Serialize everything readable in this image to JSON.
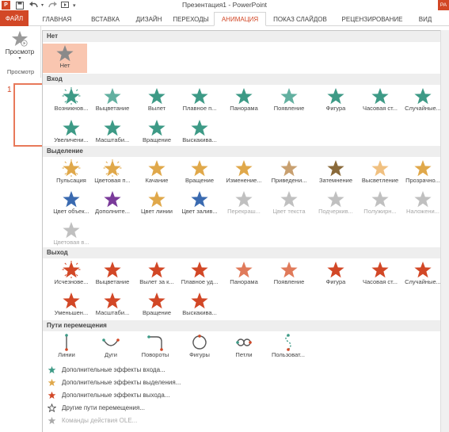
{
  "titlebar": {
    "title": "Презентация1 - PowerPoint",
    "app_logo": "P",
    "badge": "РА",
    "icons": [
      "save-icon",
      "undo-icon",
      "redo-icon",
      "start-icon",
      "customize-icon"
    ]
  },
  "tabs": [
    {
      "label": "ФАЙЛ"
    },
    {
      "label": "ГЛАВНАЯ"
    },
    {
      "label": "ВСТАВКА"
    },
    {
      "label": "ДИЗАЙН"
    },
    {
      "label": "ПЕРЕХОДЫ"
    },
    {
      "label": "АНИМАЦИЯ"
    },
    {
      "label": "ПОКАЗ СЛАЙДОВ"
    },
    {
      "label": "РЕЦЕНЗИРОВАНИЕ"
    },
    {
      "label": "ВИД"
    }
  ],
  "preview": {
    "button_label": "Просмотр",
    "group_label": "Просмотр"
  },
  "slide_thumb": {
    "number": "1"
  },
  "gallery": {
    "sections": [
      {
        "title": "Нет",
        "items": [
          {
            "label": "Нет",
            "color": "#8a8a8a",
            "icon": "star-none-icon",
            "selected": true
          }
        ]
      },
      {
        "title": "Вход",
        "items": [
          {
            "label": "Возникнов...",
            "color": "#3d9a86",
            "icon": "appear-burst-icon"
          },
          {
            "label": "Выцветание",
            "color": "#62b0a0",
            "icon": "fade-star-icon"
          },
          {
            "label": "Вылет",
            "color": "#3d9a86",
            "icon": "fly-in-icon"
          },
          {
            "label": "Плавное п...",
            "color": "#3d9a86",
            "icon": "float-in-icon"
          },
          {
            "label": "Панорама",
            "color": "#3d9a86",
            "icon": "split-icon"
          },
          {
            "label": "Появление",
            "color": "#62b0a0",
            "icon": "wipe-icon"
          },
          {
            "label": "Фигура",
            "color": "#3d9a86",
            "icon": "shape-icon"
          },
          {
            "label": "Часовая ст...",
            "color": "#3d9a86",
            "icon": "wheel-icon"
          },
          {
            "label": "Случайные...",
            "color": "#3d9a86",
            "icon": "random-bars-icon"
          },
          {
            "label": "Увеличени...",
            "color": "#3d9a86",
            "icon": "grow-turn-icon"
          },
          {
            "label": "Масштаби...",
            "color": "#3d9a86",
            "icon": "zoom-icon"
          },
          {
            "label": "Вращение",
            "color": "#3d9a86",
            "icon": "swivel-icon"
          },
          {
            "label": "Выскакива...",
            "color": "#3d9a86",
            "icon": "bounce-icon"
          }
        ]
      },
      {
        "title": "Выделение",
        "items": [
          {
            "label": "Пульсация",
            "color": "#e0a84a",
            "icon": "pulse-icon"
          },
          {
            "label": "Цветовая п...",
            "color": "#e0a84a",
            "icon": "color-pulse-icon"
          },
          {
            "label": "Качание",
            "color": "#e0a84a",
            "icon": "teeter-icon"
          },
          {
            "label": "Вращение",
            "color": "#e0a84a",
            "icon": "spin-icon"
          },
          {
            "label": "Изменение...",
            "color": "#e0a84a",
            "icon": "grow-shrink-icon"
          },
          {
            "label": "Приведени...",
            "color": "#c8a070",
            "icon": "desaturate-icon"
          },
          {
            "label": "Затемнение",
            "color": "#8a6a3a",
            "icon": "darken-icon"
          },
          {
            "label": "Высветление",
            "color": "#f0c080",
            "icon": "lighten-icon"
          },
          {
            "label": "Прозрачно...",
            "color": "#e0a84a",
            "icon": "transparency-icon"
          },
          {
            "label": "Цвет объек...",
            "color": "#3a6ab0",
            "icon": "object-color-icon"
          },
          {
            "label": "Дополните...",
            "color": "#7a3a9a",
            "icon": "complementary-color-icon"
          },
          {
            "label": "Цвет линии",
            "color": "#e0a84a",
            "icon": "line-color-icon"
          },
          {
            "label": "Цвет залив...",
            "color": "#3a6ab0",
            "icon": "fill-color-icon"
          },
          {
            "label": "Перекраш...",
            "color": "#b0b0b0",
            "icon": "brush-color-icon",
            "disabled": true
          },
          {
            "label": "Цвет текста",
            "color": "#b0b0b0",
            "icon": "font-color-icon",
            "disabled": true
          },
          {
            "label": "Подчеркив...",
            "color": "#b0b0b0",
            "icon": "underline-icon",
            "disabled": true
          },
          {
            "label": "Полужирн...",
            "color": "#b0b0b0",
            "icon": "bold-flash-icon",
            "disabled": true
          },
          {
            "label": "Наложени...",
            "color": "#b0b0b0",
            "icon": "bold-reveal-icon",
            "disabled": true
          },
          {
            "label": "Цветовая в...",
            "color": "#b0b0b0",
            "icon": "wave-icon",
            "disabled": true
          }
        ]
      },
      {
        "title": "Выход",
        "items": [
          {
            "label": "Исчезнове...",
            "color": "#d24726",
            "icon": "disappear-burst-icon"
          },
          {
            "label": "Выцветание",
            "color": "#d24726",
            "icon": "fade-out-icon"
          },
          {
            "label": "Вылет за к...",
            "color": "#d24726",
            "icon": "fly-out-icon"
          },
          {
            "label": "Плавное уд...",
            "color": "#d24726",
            "icon": "float-out-icon"
          },
          {
            "label": "Панорама",
            "color": "#e07a5a",
            "icon": "split-out-icon"
          },
          {
            "label": "Появление",
            "color": "#e07a5a",
            "icon": "wipe-out-icon"
          },
          {
            "label": "Фигура",
            "color": "#d24726",
            "icon": "shape-out-icon"
          },
          {
            "label": "Часовая ст...",
            "color": "#d24726",
            "icon": "wheel-out-icon"
          },
          {
            "label": "Случайные...",
            "color": "#d24726",
            "icon": "random-bars-out-icon"
          },
          {
            "label": "Уменьшен...",
            "color": "#d24726",
            "icon": "shrink-turn-icon"
          },
          {
            "label": "Масштаби...",
            "color": "#d24726",
            "icon": "zoom-out-icon"
          },
          {
            "label": "Вращение",
            "color": "#d24726",
            "icon": "swivel-out-icon"
          },
          {
            "label": "Выскакива...",
            "color": "#d24726",
            "icon": "bounce-out-icon"
          }
        ]
      },
      {
        "title": "Пути перемещения",
        "items": [
          {
            "label": "Линии",
            "color": "#555555",
            "icon": "path-lines-icon"
          },
          {
            "label": "Дуги",
            "color": "#555555",
            "icon": "path-arcs-icon"
          },
          {
            "label": "Повороты",
            "color": "#555555",
            "icon": "path-turns-icon"
          },
          {
            "label": "Фигуры",
            "color": "#555555",
            "icon": "path-shapes-icon"
          },
          {
            "label": "Петли",
            "color": "#555555",
            "icon": "path-loops-icon"
          },
          {
            "label": "Пользоват...",
            "color": "#555555",
            "icon": "path-custom-icon"
          }
        ]
      }
    ],
    "footer_links": [
      {
        "label": "Дополнительные эффекты входа...",
        "color": "#3d9a86",
        "icon": "more-entrance-icon"
      },
      {
        "label": "Дополнительные эффекты выделения...",
        "color": "#e0a84a",
        "icon": "more-emphasis-icon"
      },
      {
        "label": "Дополнительные эффекты выхода...",
        "color": "#d24726",
        "icon": "more-exit-icon"
      },
      {
        "label": "Другие пути перемещения...",
        "color": "#444444",
        "icon": "more-paths-icon"
      },
      {
        "label": "Команды действия OLE...",
        "color": "#aaaaaa",
        "icon": "ole-actions-icon",
        "disabled": true
      }
    ]
  }
}
